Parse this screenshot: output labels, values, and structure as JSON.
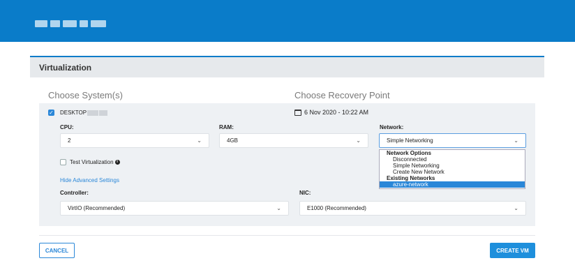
{
  "panel": {
    "title": "Virtualization"
  },
  "sections": {
    "systems_title": "Choose System(s)",
    "recovery_title": "Choose Recovery Point"
  },
  "system": {
    "name": "DESKTOP",
    "checked": true,
    "recovery_point": "6 Nov 2020 - 10:22 AM"
  },
  "fields": {
    "cpu": {
      "label": "CPU:",
      "value": "2"
    },
    "ram": {
      "label": "RAM:",
      "value": "4GB"
    },
    "network": {
      "label": "Network:",
      "value": "Simple Networking"
    },
    "controller": {
      "label": "Controller:",
      "value": "VirtIO (Recommended)"
    },
    "nic": {
      "label": "NIC:",
      "value": "E1000 (Recommended)"
    }
  },
  "test_virtualization": {
    "label": "Test Virtualization",
    "checked": false
  },
  "advanced_link": "Hide Advanced Settings",
  "network_dropdown": {
    "groups": [
      {
        "label": "Network Options",
        "options": [
          "Disconnected",
          "Simple Networking",
          "Create New Network"
        ]
      },
      {
        "label": "Existing Networks",
        "options": [
          "azure-network"
        ]
      }
    ],
    "highlighted": "azure-network"
  },
  "buttons": {
    "cancel": "CANCEL",
    "create": "CREATE VM"
  },
  "colors": {
    "brand_blue": "#0a7cc9",
    "accent": "#2a87d8",
    "panel_header_bg": "#e6e9ec"
  },
  "icons": {
    "calendar": "calendar-icon",
    "info": "info-icon",
    "chevron": "chevron-down-icon"
  }
}
